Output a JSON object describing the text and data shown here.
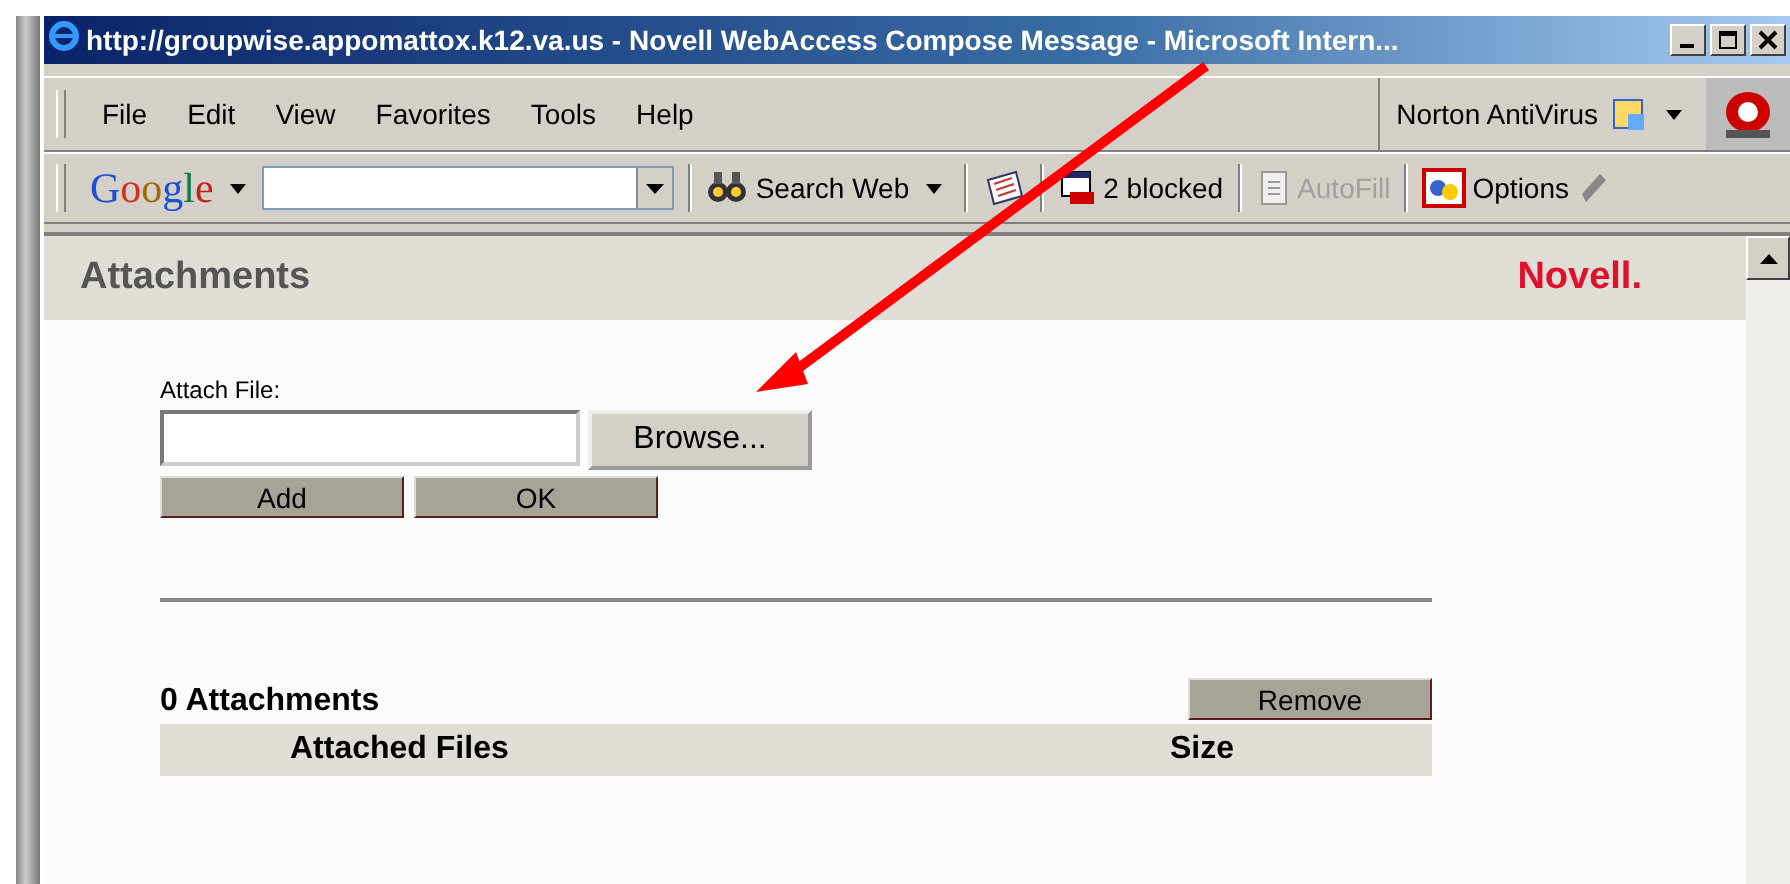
{
  "window": {
    "title": "http://groupwise.appomattox.k12.va.us - Novell WebAccess Compose Message - Microsoft Intern..."
  },
  "menu": [
    "File",
    "Edit",
    "View",
    "Favorites",
    "Tools",
    "Help"
  ],
  "norton": {
    "label": "Norton AntiVirus"
  },
  "google_toolbar": {
    "logo": "Google",
    "items": [
      {
        "kind": "search",
        "label": "Search Web",
        "disabled": false
      },
      {
        "kind": "blocked",
        "label": "2 blocked",
        "disabled": false
      },
      {
        "kind": "autofill",
        "label": "AutoFill",
        "disabled": true
      },
      {
        "kind": "options",
        "label": "Options",
        "disabled": false
      }
    ]
  },
  "page": {
    "title": "Attachments",
    "logo": "Novell.",
    "attach_label": "Attach File:",
    "browse_button": "Browse...",
    "buttons": [
      "Add",
      "OK"
    ],
    "count": "0 Attachments",
    "remove_button": "Remove",
    "table": {
      "columns": [
        "Attached Files",
        "Size"
      ]
    }
  }
}
